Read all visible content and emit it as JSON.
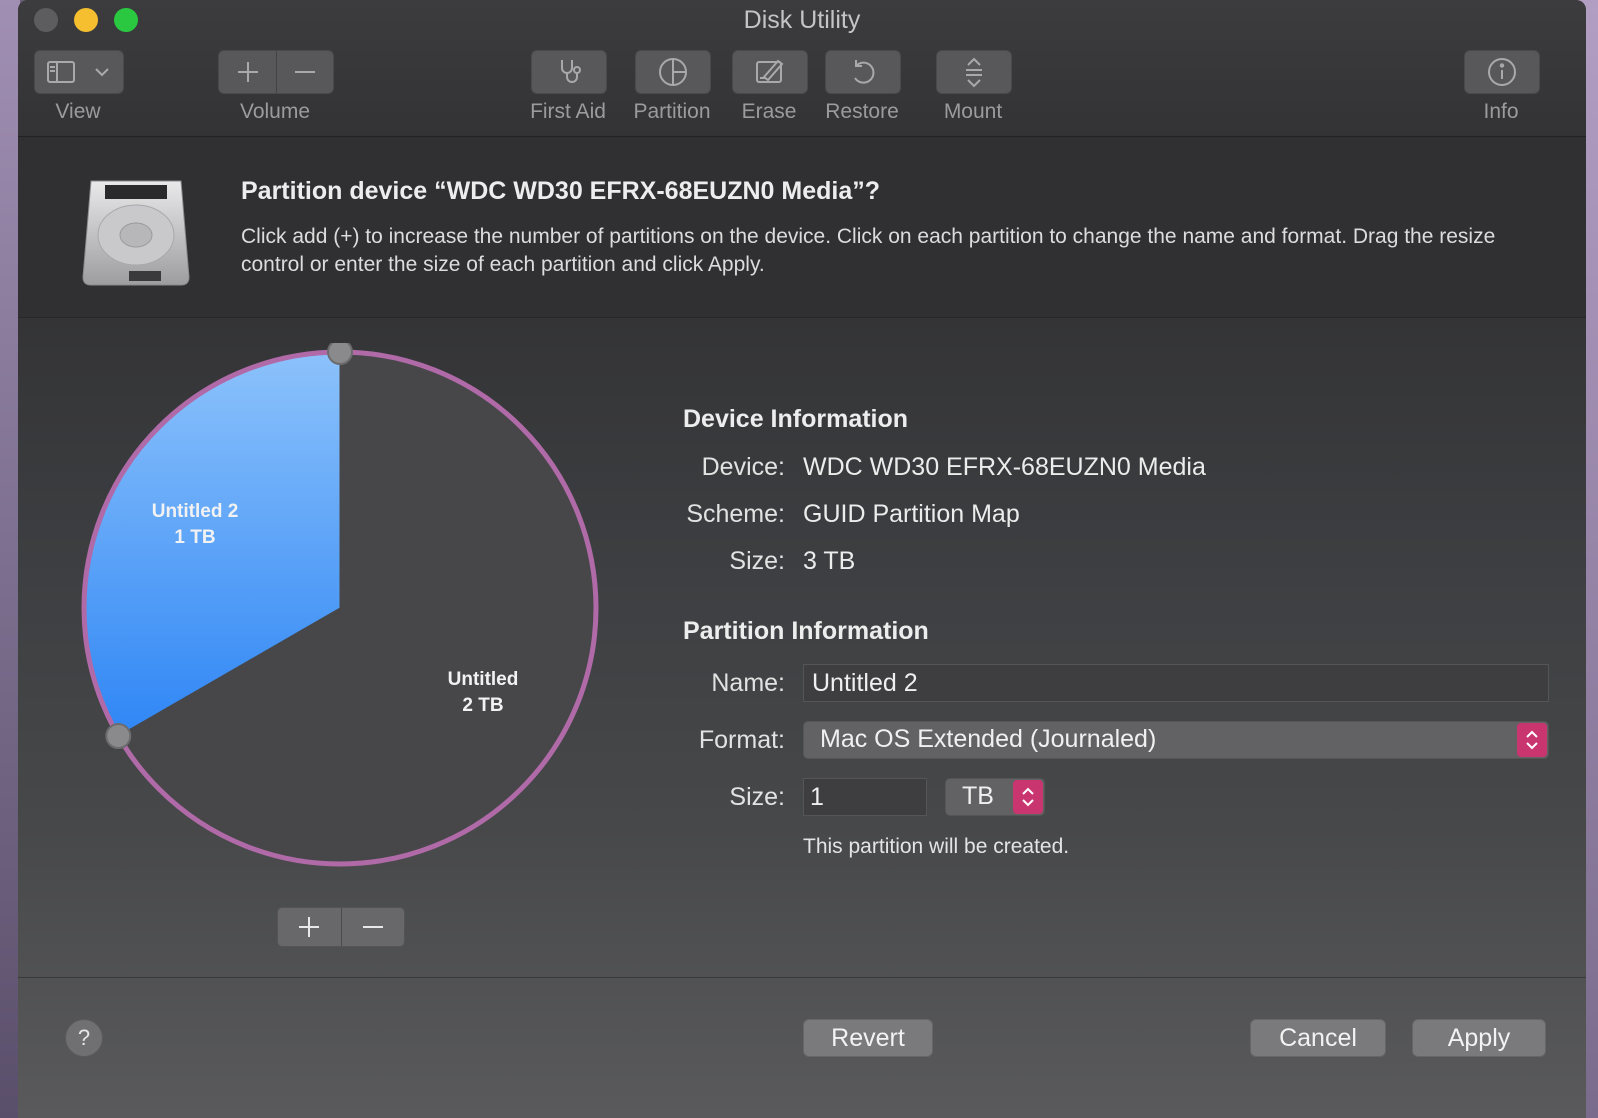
{
  "window": {
    "title": "Disk Utility"
  },
  "toolbar": {
    "view_label": "View",
    "volume_label": "Volume",
    "first_aid_label": "First Aid",
    "partition_label": "Partition",
    "erase_label": "Erase",
    "restore_label": "Restore",
    "mount_label": "Mount",
    "info_label": "Info"
  },
  "sheet": {
    "title": "Partition device “WDC WD30 EFRX-68EUZN0 Media”?",
    "description": "Click add (+) to increase the number of partitions on the device. Click on each partition to change the name and format. Drag the resize control or enter the size of each partition and click Apply."
  },
  "pie": {
    "partitions": [
      {
        "name": "Untitled 2",
        "size": "1 TB",
        "value_tb": 1,
        "color": "#4a9af8",
        "selected": true
      },
      {
        "name": "Untitled",
        "size": "2 TB",
        "value_tb": 2,
        "color": "#474749",
        "selected": false
      }
    ],
    "ring_color": "#b06aa8"
  },
  "device_info": {
    "heading": "Device Information",
    "device_label": "Device:",
    "device_value": "WDC WD30 EFRX-68EUZN0 Media",
    "scheme_label": "Scheme:",
    "scheme_value": "GUID Partition Map",
    "size_label": "Size:",
    "size_value": "3 TB"
  },
  "partition_info": {
    "heading": "Partition Information",
    "name_label": "Name:",
    "name_value": "Untitled 2",
    "format_label": "Format:",
    "format_value": "Mac OS Extended (Journaled)",
    "size_label": "Size:",
    "size_value": "1",
    "size_unit": "TB",
    "note": "This partition will be created."
  },
  "buttons": {
    "help": "?",
    "revert": "Revert",
    "cancel": "Cancel",
    "apply": "Apply"
  },
  "colors": {
    "accent": "#c8356f",
    "selection": "#4a9af8"
  }
}
